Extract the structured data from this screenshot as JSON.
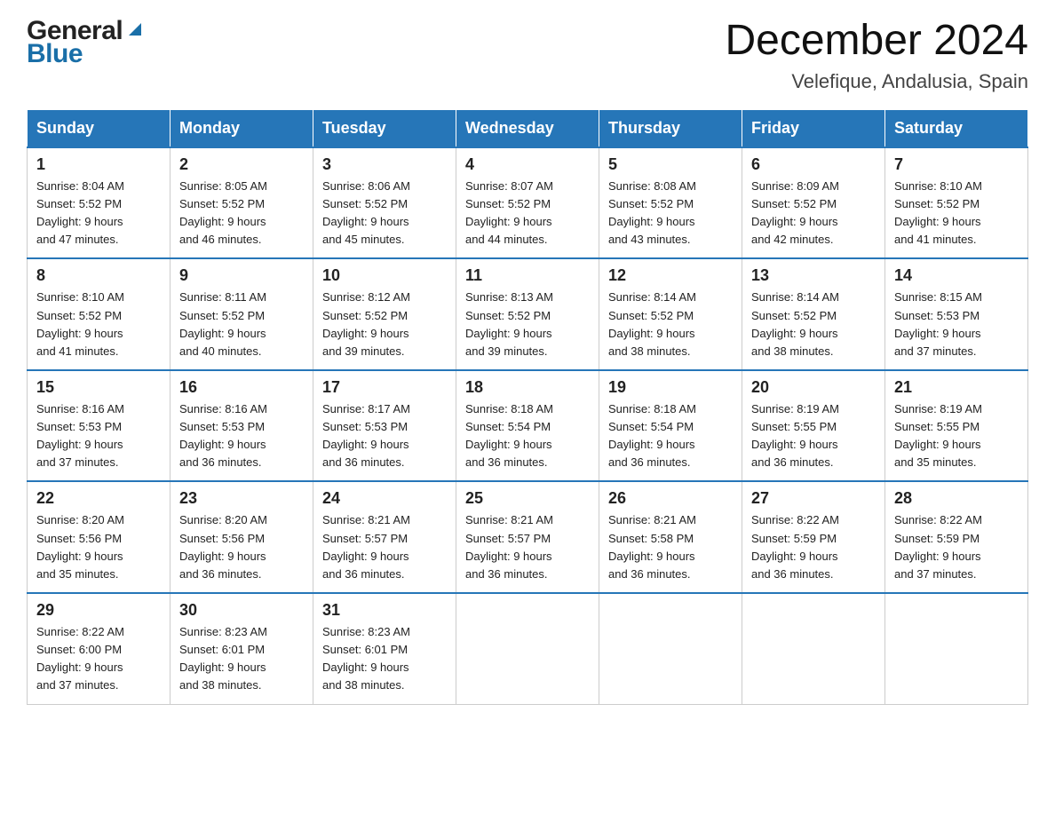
{
  "header": {
    "logo_text_general": "General",
    "logo_text_blue": "Blue",
    "calendar_title": "December 2024",
    "calendar_subtitle": "Velefique, Andalusia, Spain"
  },
  "weekdays": [
    "Sunday",
    "Monday",
    "Tuesday",
    "Wednesday",
    "Thursday",
    "Friday",
    "Saturday"
  ],
  "weeks": [
    [
      {
        "day": "1",
        "sunrise": "8:04 AM",
        "sunset": "5:52 PM",
        "daylight": "9 hours and 47 minutes."
      },
      {
        "day": "2",
        "sunrise": "8:05 AM",
        "sunset": "5:52 PM",
        "daylight": "9 hours and 46 minutes."
      },
      {
        "day": "3",
        "sunrise": "8:06 AM",
        "sunset": "5:52 PM",
        "daylight": "9 hours and 45 minutes."
      },
      {
        "day": "4",
        "sunrise": "8:07 AM",
        "sunset": "5:52 PM",
        "daylight": "9 hours and 44 minutes."
      },
      {
        "day": "5",
        "sunrise": "8:08 AM",
        "sunset": "5:52 PM",
        "daylight": "9 hours and 43 minutes."
      },
      {
        "day": "6",
        "sunrise": "8:09 AM",
        "sunset": "5:52 PM",
        "daylight": "9 hours and 42 minutes."
      },
      {
        "day": "7",
        "sunrise": "8:10 AM",
        "sunset": "5:52 PM",
        "daylight": "9 hours and 41 minutes."
      }
    ],
    [
      {
        "day": "8",
        "sunrise": "8:10 AM",
        "sunset": "5:52 PM",
        "daylight": "9 hours and 41 minutes."
      },
      {
        "day": "9",
        "sunrise": "8:11 AM",
        "sunset": "5:52 PM",
        "daylight": "9 hours and 40 minutes."
      },
      {
        "day": "10",
        "sunrise": "8:12 AM",
        "sunset": "5:52 PM",
        "daylight": "9 hours and 39 minutes."
      },
      {
        "day": "11",
        "sunrise": "8:13 AM",
        "sunset": "5:52 PM",
        "daylight": "9 hours and 39 minutes."
      },
      {
        "day": "12",
        "sunrise": "8:14 AM",
        "sunset": "5:52 PM",
        "daylight": "9 hours and 38 minutes."
      },
      {
        "day": "13",
        "sunrise": "8:14 AM",
        "sunset": "5:52 PM",
        "daylight": "9 hours and 38 minutes."
      },
      {
        "day": "14",
        "sunrise": "8:15 AM",
        "sunset": "5:53 PM",
        "daylight": "9 hours and 37 minutes."
      }
    ],
    [
      {
        "day": "15",
        "sunrise": "8:16 AM",
        "sunset": "5:53 PM",
        "daylight": "9 hours and 37 minutes."
      },
      {
        "day": "16",
        "sunrise": "8:16 AM",
        "sunset": "5:53 PM",
        "daylight": "9 hours and 36 minutes."
      },
      {
        "day": "17",
        "sunrise": "8:17 AM",
        "sunset": "5:53 PM",
        "daylight": "9 hours and 36 minutes."
      },
      {
        "day": "18",
        "sunrise": "8:18 AM",
        "sunset": "5:54 PM",
        "daylight": "9 hours and 36 minutes."
      },
      {
        "day": "19",
        "sunrise": "8:18 AM",
        "sunset": "5:54 PM",
        "daylight": "9 hours and 36 minutes."
      },
      {
        "day": "20",
        "sunrise": "8:19 AM",
        "sunset": "5:55 PM",
        "daylight": "9 hours and 36 minutes."
      },
      {
        "day": "21",
        "sunrise": "8:19 AM",
        "sunset": "5:55 PM",
        "daylight": "9 hours and 35 minutes."
      }
    ],
    [
      {
        "day": "22",
        "sunrise": "8:20 AM",
        "sunset": "5:56 PM",
        "daylight": "9 hours and 35 minutes."
      },
      {
        "day": "23",
        "sunrise": "8:20 AM",
        "sunset": "5:56 PM",
        "daylight": "9 hours and 36 minutes."
      },
      {
        "day": "24",
        "sunrise": "8:21 AM",
        "sunset": "5:57 PM",
        "daylight": "9 hours and 36 minutes."
      },
      {
        "day": "25",
        "sunrise": "8:21 AM",
        "sunset": "5:57 PM",
        "daylight": "9 hours and 36 minutes."
      },
      {
        "day": "26",
        "sunrise": "8:21 AM",
        "sunset": "5:58 PM",
        "daylight": "9 hours and 36 minutes."
      },
      {
        "day": "27",
        "sunrise": "8:22 AM",
        "sunset": "5:59 PM",
        "daylight": "9 hours and 36 minutes."
      },
      {
        "day": "28",
        "sunrise": "8:22 AM",
        "sunset": "5:59 PM",
        "daylight": "9 hours and 37 minutes."
      }
    ],
    [
      {
        "day": "29",
        "sunrise": "8:22 AM",
        "sunset": "6:00 PM",
        "daylight": "9 hours and 37 minutes."
      },
      {
        "day": "30",
        "sunrise": "8:23 AM",
        "sunset": "6:01 PM",
        "daylight": "9 hours and 38 minutes."
      },
      {
        "day": "31",
        "sunrise": "8:23 AM",
        "sunset": "6:01 PM",
        "daylight": "9 hours and 38 minutes."
      },
      null,
      null,
      null,
      null
    ]
  ],
  "labels": {
    "sunrise": "Sunrise:",
    "sunset": "Sunset:",
    "daylight": "Daylight:"
  }
}
